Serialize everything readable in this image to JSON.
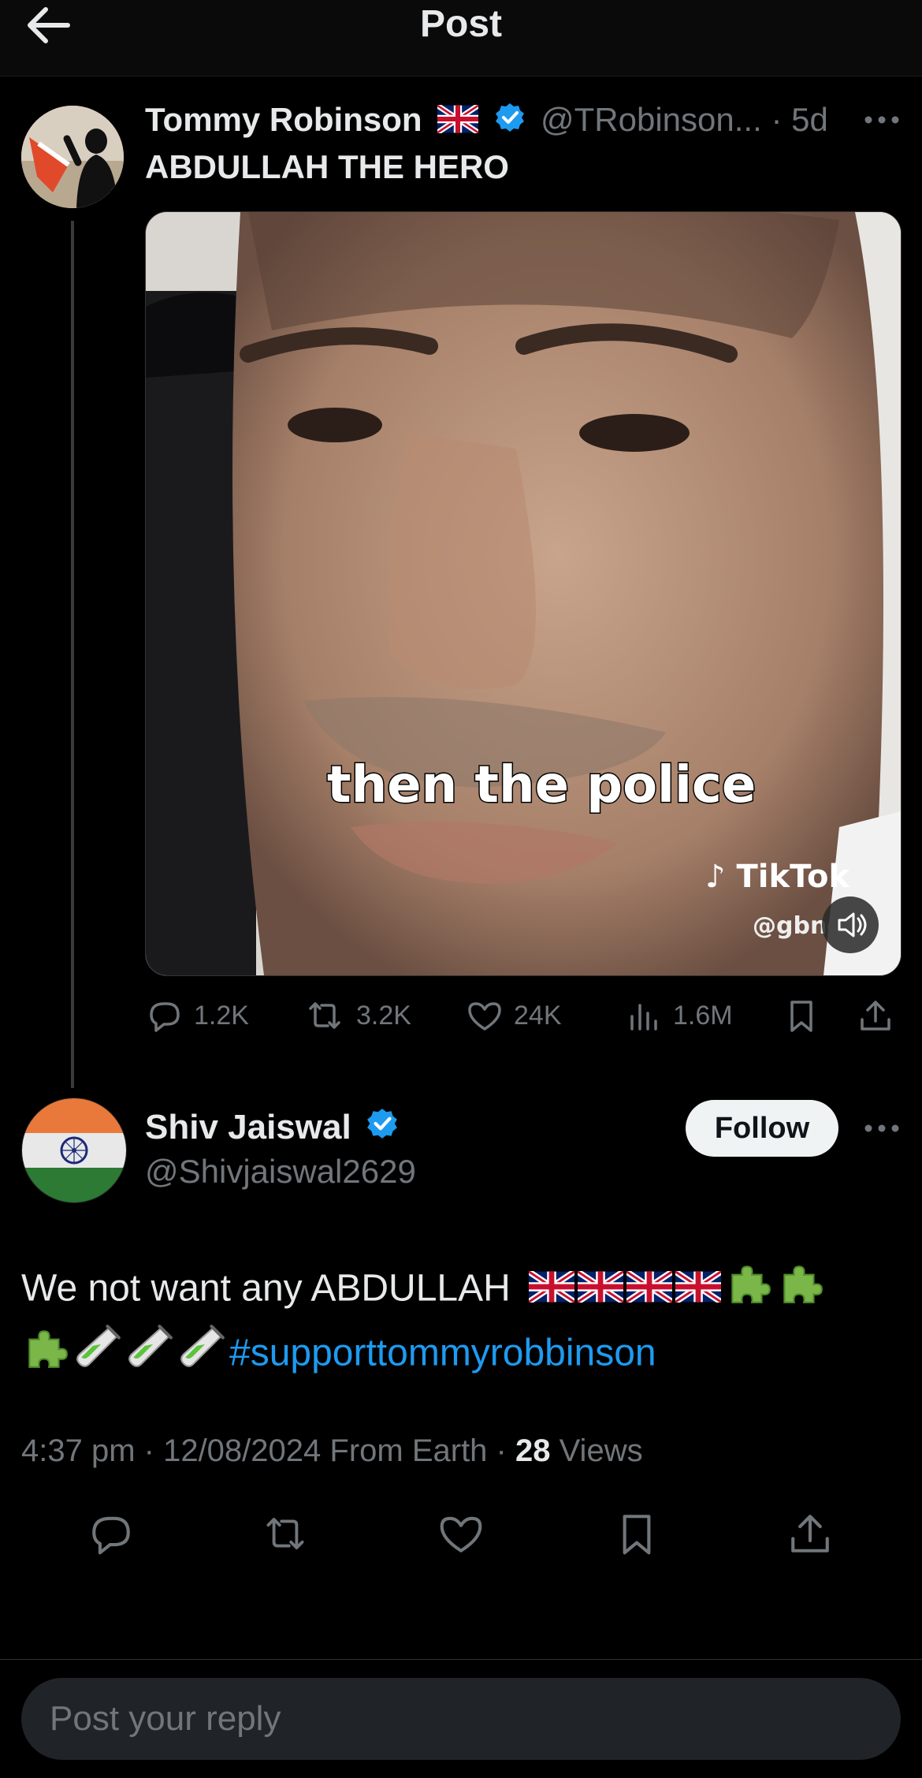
{
  "header": {
    "title": "Post"
  },
  "parent_post": {
    "author_name": "Tommy Robinson",
    "author_handle": "@TRobinson...",
    "time_ago": "· 5d",
    "text": "ABDULLAH THE HERO",
    "media": {
      "caption": "then the police",
      "watermark_brand": "TikTok",
      "watermark_handle": "@gbnews"
    },
    "stats": {
      "replies": "1.2K",
      "reposts": "3.2K",
      "likes": "24K",
      "views": "1.6M"
    }
  },
  "reply_post": {
    "author_name": "Shiv Jaiswal",
    "author_handle": "@Shivjaiswal2629",
    "follow_label": "Follow",
    "text_main": "We not want any ABDULLAH",
    "hashtag": "#supporttommyrobbinson",
    "meta_time": "4:37 pm · 12/08/2024 From Earth · ",
    "views_count": "28",
    "views_label": " Views"
  },
  "composer": {
    "placeholder": "Post your reply"
  },
  "colors": {
    "accent": "#1d9bf0",
    "muted": "#71767b",
    "background": "#000000"
  },
  "icons": [
    "back-arrow-icon",
    "uk-flag-icon",
    "verified-badge-icon",
    "more-icon",
    "reply-icon",
    "repost-icon",
    "like-icon",
    "views-icon",
    "bookmark-icon",
    "share-icon",
    "puzzle-emoji",
    "test-tube-emoji",
    "india-flag-avatar"
  ]
}
